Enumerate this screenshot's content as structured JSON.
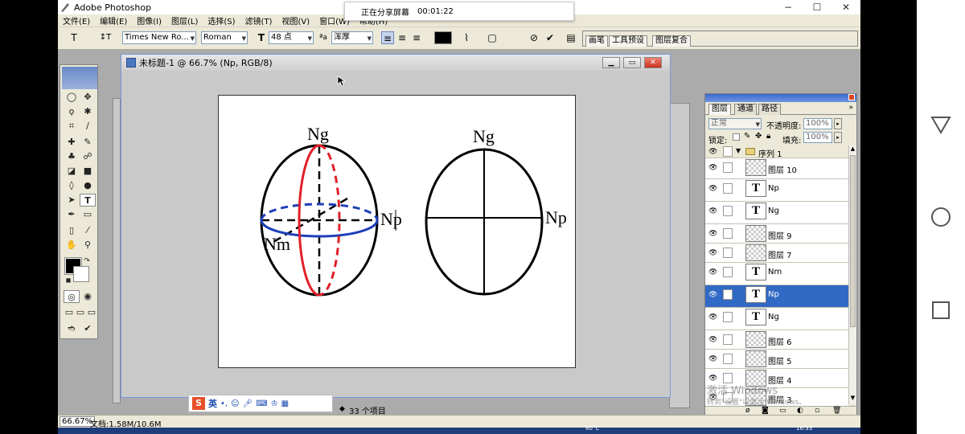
{
  "app": {
    "title": "Adobe Photoshop",
    "window_controls": [
      "−",
      "☐",
      "✕"
    ]
  },
  "menu": [
    "文件(E)",
    "编辑(E)",
    "图像(I)",
    "图层(L)",
    "选择(S)",
    "滤镜(T)",
    "视图(V)",
    "窗口(W)",
    "帮助(H)"
  ],
  "share": {
    "label": "正在分享屏幕",
    "timer": "00:01:22"
  },
  "options": {
    "tool_glyph": "T",
    "font_family": "Times New Ro...",
    "font_style": "Roman",
    "font_size": "48 点",
    "antialias_prefix": "ªa",
    "antialias": "浑厚",
    "text_color": "#000000",
    "palette_tabs": [
      "画笔",
      "工具预设",
      "图层复合"
    ]
  },
  "document": {
    "title": "未标题-1 @ 66.7% (Np, RGB/8)",
    "left_figure": {
      "top": "Ng",
      "right": "Np",
      "bottom_left": "Nm"
    },
    "right_figure": {
      "top": "Ng",
      "right": "Np"
    },
    "colors": {
      "red": "#e0202a",
      "blue": "#1d3fb8",
      "black": "#000000"
    }
  },
  "layers_panel": {
    "tabs": [
      "图层",
      "通道",
      "路径"
    ],
    "blend_mode": "正常",
    "opacity_label": "不透明度:",
    "opacity_value": "100%",
    "lock_label": "锁定:",
    "fill_label": "填充:",
    "fill_value": "100%",
    "group_name": "序列 1",
    "layers": [
      {
        "name": "图层 10",
        "type": "raster",
        "selected": false
      },
      {
        "name": "Np",
        "type": "text",
        "selected": false
      },
      {
        "name": "Ng",
        "type": "text",
        "selected": false
      },
      {
        "name": "图层 9",
        "type": "raster",
        "selected": false
      },
      {
        "name": "图层 7",
        "type": "raster",
        "selected": false
      },
      {
        "name": "Nm",
        "type": "text",
        "selected": false
      },
      {
        "name": "Np",
        "type": "text",
        "selected": true
      },
      {
        "name": "Ng",
        "type": "text",
        "selected": false
      },
      {
        "name": "图层 6",
        "type": "raster",
        "selected": false
      },
      {
        "name": "图层 5",
        "type": "raster",
        "selected": false
      },
      {
        "name": "图层 4",
        "type": "raster",
        "selected": false
      },
      {
        "name": "图层 3",
        "type": "raster",
        "selected": false
      }
    ],
    "watermark_line1": "激活 Windows",
    "watermark_line2": "转到\"设置\"以激活 Windows。"
  },
  "status": {
    "zoom": "66.67%",
    "doc_size": "文档:1.58M/10.6M",
    "item_count": "33 个项目",
    "ime_label": "英"
  },
  "taskbar": {
    "temp": "60°C",
    "clock": "16:33"
  }
}
